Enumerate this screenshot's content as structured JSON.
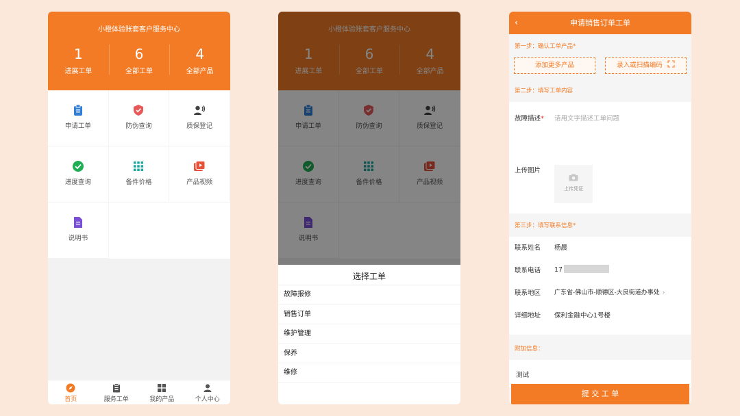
{
  "home": {
    "title": "小橙体验账套客户服务中心",
    "stats": [
      {
        "num": "1",
        "label": "进展工单"
      },
      {
        "num": "6",
        "label": "全部工单"
      },
      {
        "num": "4",
        "label": "全部产品"
      }
    ],
    "grid": [
      {
        "label": "申请工单",
        "icon": "clipboard-icon",
        "color": "#2f7fd8"
      },
      {
        "label": "防伪查询",
        "icon": "shield-icon",
        "color": "#e85a5a"
      },
      {
        "label": "质保登记",
        "icon": "user-voice-icon",
        "color": "#444444"
      },
      {
        "label": "进度查询",
        "icon": "check-circle-icon",
        "color": "#1fae55"
      },
      {
        "label": "备件价格",
        "icon": "grid-icon",
        "color": "#1ea6a0"
      },
      {
        "label": "产品视频",
        "icon": "video-icon",
        "color": "#e8523b"
      },
      {
        "label": "说明书",
        "icon": "document-icon",
        "color": "#7a4fd6"
      }
    ],
    "tabs": [
      {
        "label": "首页",
        "icon": "compass-icon"
      },
      {
        "label": "服务工单",
        "icon": "clipboard-list-icon"
      },
      {
        "label": "我的产品",
        "icon": "apps-icon"
      },
      {
        "label": "个人中心",
        "icon": "person-icon"
      }
    ]
  },
  "picker": {
    "title": "选择工单",
    "options": [
      "故障报修",
      "销售订单",
      "维护管理",
      "保养",
      "维修"
    ]
  },
  "order": {
    "title": "申请销售订单工单",
    "step1": "第一步：确认工单产品*",
    "add_more": "添加更多产品",
    "scan": "录入或扫描编码",
    "step2": "第二步：填写工单内容",
    "desc_label": "故障描述",
    "desc_required": "*",
    "desc_placeholder": "请用文字描述工单问题",
    "upload_label": "上传图片",
    "upload_hint": "上传凭证",
    "step3": "第三步：填写联系信息*",
    "contact_name_label": "联系姓名",
    "contact_name": "杨晨",
    "contact_phone_label": "联系电话",
    "contact_phone": "17",
    "region_label": "联系地区",
    "region": "广东省-佛山市-顺德区-大良街道办事处",
    "address_label": "详细地址",
    "address": "保利金融中心1号楼",
    "extra_title": "附加信息：",
    "extra_value": "测试",
    "submit": "提 交 工 单"
  },
  "colors": {
    "accent": "#f47b25",
    "background": "#fce8da"
  }
}
